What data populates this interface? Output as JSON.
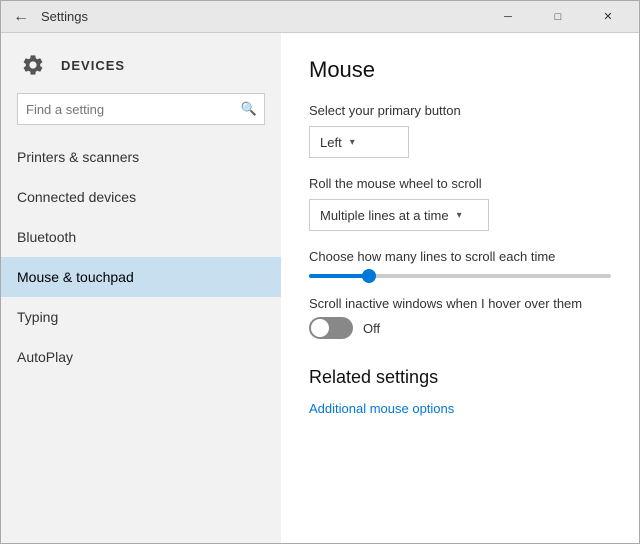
{
  "titlebar": {
    "back_icon": "←",
    "title": "Settings",
    "minimize_label": "─",
    "maximize_label": "□",
    "close_label": "✕"
  },
  "sidebar": {
    "section_title": "DEVICES",
    "search_placeholder": "Find a setting",
    "nav_items": [
      {
        "id": "printers",
        "label": "Printers & scanners",
        "active": false
      },
      {
        "id": "connected",
        "label": "Connected devices",
        "active": false
      },
      {
        "id": "bluetooth",
        "label": "Bluetooth",
        "active": false
      },
      {
        "id": "mouse",
        "label": "Mouse & touchpad",
        "active": true
      },
      {
        "id": "typing",
        "label": "Typing",
        "active": false
      },
      {
        "id": "autoplay",
        "label": "AutoPlay",
        "active": false
      }
    ]
  },
  "content": {
    "title": "Mouse",
    "primary_button_label": "Select your primary button",
    "primary_button_value": "Left",
    "scroll_wheel_label": "Roll the mouse wheel to scroll",
    "scroll_wheel_value": "Multiple lines at a time",
    "scroll_lines_label": "Choose how many lines to scroll each time",
    "scroll_percent": 20,
    "inactive_scroll_label": "Scroll inactive windows when I hover over them",
    "inactive_scroll_state": "Off",
    "related_title": "Related settings",
    "additional_link": "Additional mouse options"
  }
}
